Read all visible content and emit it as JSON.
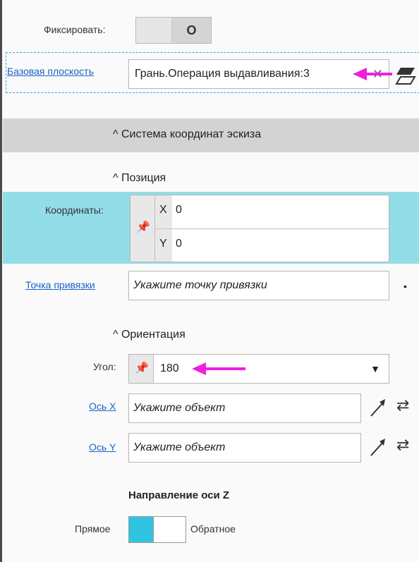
{
  "fix": {
    "label": "Фиксировать:",
    "toggle_on": "O"
  },
  "base_plane": {
    "label": "Базовая плоскость",
    "value": "Грань.Операция выдавливания:3"
  },
  "section": {
    "title": "Система координат эскиза"
  },
  "position": {
    "title": "Позиция",
    "coords_label": "Координаты:",
    "x_label": "X",
    "x_value": "0",
    "y_label": "Y",
    "y_value": "0"
  },
  "anchor": {
    "label": "Точка привязки",
    "placeholder": "Укажите точку привязки"
  },
  "orientation": {
    "title": "Ориентация",
    "angle_label": "Угол:",
    "angle_value": "180",
    "axis_x_label": "Ось X",
    "axis_y_label": "Ось Y",
    "axis_placeholder": "Укажите объект"
  },
  "zdir": {
    "title": "Направление оси Z",
    "direct": "Прямое",
    "reverse": "Обратное",
    "selected": "Прямое"
  },
  "colors": {
    "accent": "#31c4e0",
    "highlight_band": "#93dde8",
    "annotation_arrow": "#f01ee0",
    "link": "#1a63c7"
  }
}
